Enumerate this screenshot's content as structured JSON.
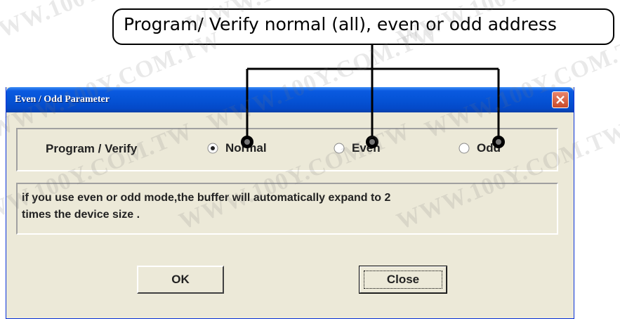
{
  "callout": {
    "text": "Program/ Verify normal (all), even or odd address"
  },
  "window": {
    "title": "Even / Odd Parameter"
  },
  "group": {
    "label": "Program / Verify",
    "options": [
      {
        "label": "Normal",
        "selected": true
      },
      {
        "label": "Even",
        "selected": false
      },
      {
        "label": "Odd",
        "selected": false
      }
    ]
  },
  "info": {
    "line1": "if you use even or odd mode,the buffer will automatically expand to 2",
    "line2": "times the device size ."
  },
  "buttons": {
    "ok_label": "OK",
    "close_label": "Close"
  },
  "watermark": {
    "text": "WWW.100Y.COM.TW"
  }
}
